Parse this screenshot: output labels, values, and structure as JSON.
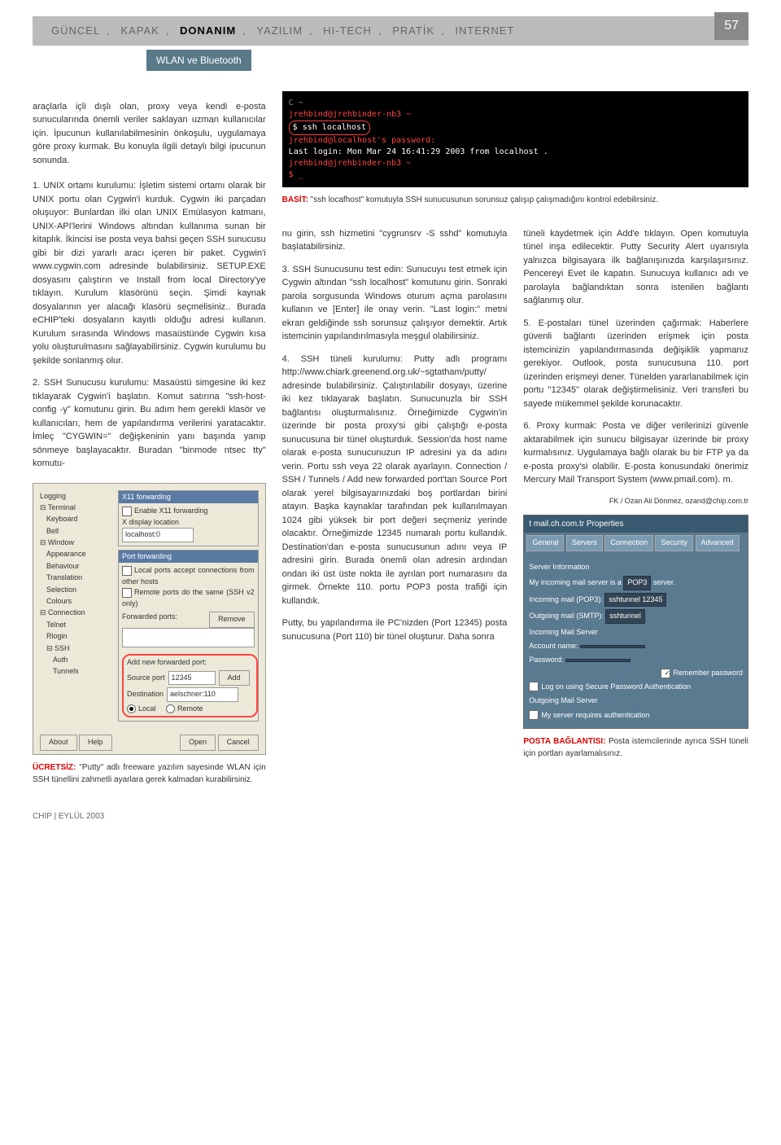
{
  "nav": {
    "items": [
      "GÜNCEL",
      "KAPAK",
      "DONANIM",
      "YAZILIM",
      "HI-TECH",
      "PRATİK",
      "INTERNET"
    ],
    "active": 2,
    "page_num": "57"
  },
  "sub_header": "WLAN ve Bluetooth",
  "intro": "araçlarla içli dışlı olan, proxy veya kendi e-posta sunucularında önemli veriler saklayan uzman kullanıcılar için. İpucunun kullanılabilmesinin önkoşulu, uygulamaya göre proxy kurmak. Bu konuyla ilgili detaylı bilgi ipucunun sonunda.",
  "para1": "1. UNIX ortamı kurulumu: İşletim sistemi ortamı olarak bir UNIX portu olan Cygwin'i kurduk. Cygwin iki parçadan oluşuyor: Bunlardan ilki olan UNIX Emülasyon katmanı, UNIX-API'lerini Windows altından kullanıma sunan bir kitaplık. İkincisi ise posta veya bahsi geçen SSH sunucusu gibi bir dizi yararlı aracı içeren bir paket. Cygwin'i www.cygwin.com adresinde bulabilirsiniz. SETUP.EXE dosyasını çalıştırın ve Install from local Directory'ye tıklayın. Kurulum klasörünü seçin. Şimdi kaynak dosyalarının yer alacağı klasörü seçmelisiniz.. Burada eCHIP'teki dosyaların kayıtlı olduğu adresi kullanın. Kurulum sırasında Windows masaüstünde Cygwin kısa yolu oluşturulmasını sağlayabilirsiniz. Cygwin kurulumu bu şekilde sonlanmış olur.",
  "para2": "2. SSH Sunucusu kurulumu: Masaüstü simgesine iki kez tıklayarak Cygwin'i başlatın. Komut satırına \"ssh-host-config -y\" komutunu girin. Bu adım hem gerekli klasör ve kullanıcıları, hem de yapılandırma verilerini yaratacaktır. İmleç \"CYGWIN=\" değişkeninin yanı başında yanıp sönmeye başlayacaktır. Buradan \"binmode ntsec tty\" komutu-",
  "terminal": {
    "line1": "jrehbind@jrehbinder-nb3 ~",
    "line2": "$ ssh localhost",
    "line3": "jrehbind@localhost's password:",
    "line4": "Last login: Mon Mar 24 16:41:29 2003 from localhost .",
    "line5": "jrehbind@jrehbinder-nb3 ~",
    "line6": "$ _"
  },
  "terminal_caption_label": "BASİT:",
  "terminal_caption": " \"ssh locafhost\" komutuyla SSH sunucusunun sorunsuz çalışıp çalışmadığını kontrol edebilirsiniz.",
  "col2_p1": "nu girin, ssh hizmetini \"cygrunsrv -S sshd\" komutuyla başlatabilirsiniz.",
  "col2_p2": "3. SSH Sunucusunu test edin: Sunucuyu test etmek için Cygwin altından \"ssh localhost\" komutunu girin. Sonraki parola sorgusunda Windows oturum açma parolasını kullanın ve [Enter] ile onay verin. \"Last login:\" metni ekran geldiğinde ssh sorunsuz çalışıyor demektir. Artık istemcinin yapılandırılmasıyla meşgul olabilirsiniz.",
  "col2_p3": "4. SSH tüneli kurulumu: Putty adlı programı http://www.chiark.greenend.org.uk/~sgtatham/putty/ adresinde bulabilirsiniz. Çalıştırılabilir dosyayı, üzerine iki kez tıklayarak başlatın. Sunucunuzla bir SSH bağlantısı oluşturmalısınız. Örneğimizde Cygwin'in üzerinde bir posta proxy'si gibi çalıştığı e-posta sunucusuna bir tünel oluşturduk. Session'da host name olarak e-posta sunucunuzun IP adresini ya da adını verin. Portu ssh veya 22 olarak ayarlayın. Connection / SSH / Tunnels / Add new forwarded port'tan Source Port olarak yerel bilgisayarınızdaki boş portlardan birini atayın. Başka kaynaklar tarafından pek kullanılmayan 1024 gibi yüksek bir port değeri seçmeniz yerinde olacaktır. Örneğimizde 12345 numaralı portu kullandık. Destination'dan e-posta sunucusunun adını veya IP adresini girin. Burada önemli olan adresin ardından ondan iki üst üste nokta ile ayrılan port numarasını da girmek. Örnekte 110. portu POP3 posta trafiği için kullandık.",
  "col2_p4": "Putty, bu yapılandırma ile PC'nizden (Port 12345) posta sunucusuna (Port 110) bir tünel oluşturur. Daha sonra",
  "col3_p1": "tüneli kaydetmek için Add'e tıklayın. Open komutuyla tünel inşa edilecektir. Putty Security Alert uyarısıyla yalnızca bilgisayara ilk bağlanışınızda karşılaşırsınız. Pencereyi Evet ile kapatın. Sunucuya kullanıcı adı ve parolayla bağlandıktan sonra istenilen bağlantı sağlanmış olur.",
  "col3_p2": "5. E-postaları tünel üzerinden çağırmak: Haberlere güvenli bağlantı üzerinden erişmek için posta istemcinizin yapılandırmasında değişiklik yapmanız gerekiyor. Outlook, posta sunucusuna 110. port üzerinden erişmeyi dener. Tünelden yararlanabilmek için portu \"12345\" olarak değiştirmelisiniz. Veri transferi bu sayede mükemmel şekilde korunacaktır.",
  "col3_p3": "6. Proxy kurmak: Posta ve diğer verilerinizi güvenle aktarabilmek için sunucu bilgisayar üzerinde bir proxy kurmalısınız. Uygulamaya bağlı olarak bu bir FTP ya da e-posta proxy'si olabilir. E-posta konusundaki önerimiz Mercury Mail Transport System (www.pmail.com). m.",
  "author": "FK / Ozan Ali Dönmez, ozand@chip.com.tr",
  "putty": {
    "tree": [
      "Logging",
      "⊟ Terminal",
      "Keyboard",
      "Bell",
      "⊟ Window",
      "Appearance",
      "Behaviour",
      "Translation",
      "Selection",
      "Colours",
      "⊟ Connection",
      "Telnet",
      "Rlogin",
      "⊟ SSH",
      "Auth",
      "Tunnels"
    ],
    "group1_title": "X11 forwarding",
    "cb1": "Enable X11 forwarding",
    "lbl_xdisp": "X display location",
    "xdisp": "localhost:0",
    "group2_title": "Port forwarding",
    "cb2": "Local ports accept connections from other hosts",
    "cb3": "Remote ports do the same (SSH v2 only)",
    "lbl_fwdports": "Forwarded ports:",
    "btn_remove": "Remove",
    "lbl_addnew": "Add new forwarded port:",
    "lbl_srcport": "Source port",
    "srcport": "12345",
    "btn_add": "Add",
    "lbl_dest": "Destination",
    "dest": "aelschner:110",
    "radio_local": "Local",
    "radio_remote": "Remote",
    "btn_about": "About",
    "btn_help": "Help",
    "btn_open": "Open",
    "btn_cancel": "Cancel"
  },
  "putty_caption_label": "ÜCRETSİZ:",
  "putty_caption": " \"Putty\" adlı freeware yazılım sayesinde WLAN için SSH tünellini zahmetli ayarlara gerek kalmadan kurabilirsiniz.",
  "mail": {
    "title": "t mail.ch.com.tr Properties",
    "tabs": [
      "General",
      "Servers",
      "Connection",
      "Security",
      "Advanced"
    ],
    "sec1": "Server Information",
    "lbl_myinc": "My incoming mail server is a",
    "type": "POP3",
    "type2": "server.",
    "lbl_inc": "Incoming mail (POP3):",
    "inc": "sshtunnel 12345",
    "lbl_out": "Outgoing mail (SMTP):",
    "out": "sshtunnel",
    "sec2": "Incoming Mail Server",
    "lbl_acct": "Account name:",
    "lbl_pass": "Password:",
    "cb_rem": "Remember password",
    "cb_log": "Log on using Secure Password Authentication",
    "sec3": "Outgoing Mail Server",
    "cb_req": "My server requires authentication"
  },
  "mail_caption_label": "POSTA BAĞLANTISI:",
  "mail_caption": " Posta istemcilerinde ayrıca SSH tüneli için portları ayarlamalısınız.",
  "footer": "CHIP | EYLÜL 2003"
}
